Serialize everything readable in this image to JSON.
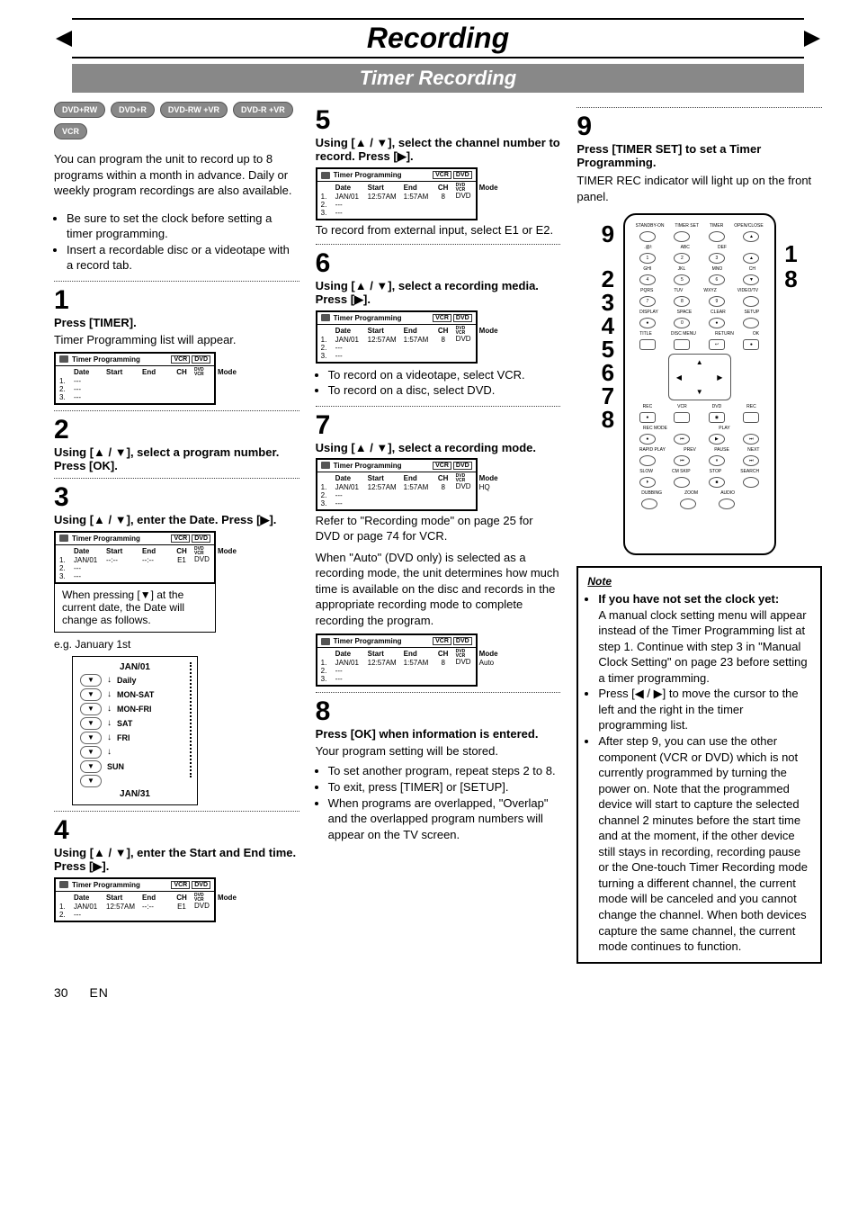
{
  "page_title": "Recording",
  "subtitle": "Timer Recording",
  "disc_badges": [
    "DVD+RW",
    "DVD+R",
    "DVD-RW +VR",
    "DVD-R +VR",
    "VCR"
  ],
  "intro_paragraph": "You can program the unit to record up to 8 programs within a month in advance. Daily or weekly program recordings are also available.",
  "intro_bullets": [
    "Be sure to set the clock before setting a timer programming.",
    "Insert a recordable disc or a videotape with a record tab."
  ],
  "timer_programming_label": "Timer Programming",
  "timer_indicators": [
    "VCR",
    "DVD"
  ],
  "timer_headers": {
    "date": "Date",
    "start": "Start",
    "end": "End",
    "ch": "CH",
    "dvdvcr_top": "DVD",
    "dvdvcr_bot": "VCR",
    "mode": "Mode"
  },
  "steps": {
    "1": {
      "title": "Press [TIMER].",
      "sub": "Timer Programming list will appear.",
      "rows": [
        {
          "n": "1.",
          "date": "---"
        },
        {
          "n": "2.",
          "date": "---"
        },
        {
          "n": "3.",
          "date": "---"
        }
      ]
    },
    "2": {
      "title": "Using [▲ / ▼], select a program number. Press [OK]."
    },
    "3": {
      "title": "Using [▲ / ▼], enter the Date. Press [▶].",
      "rows": [
        {
          "n": "1.",
          "date": "JAN/01",
          "start": "--:--",
          "end": "--:--",
          "ch": "E1",
          "dv": "DVD"
        },
        {
          "n": "2.",
          "date": "---"
        },
        {
          "n": "3.",
          "date": "---"
        }
      ],
      "callout": "When pressing [▼] at the current date, the Date will change as follows.",
      "eg": "e.g. January 1st",
      "loop": [
        "JAN/01",
        "Daily",
        "MON-SAT",
        "MON-FRI",
        "SAT",
        "FRI",
        "SUN",
        "JAN/31"
      ]
    },
    "4": {
      "title": "Using [▲ / ▼], enter the Start and End time. Press [▶].",
      "rows": [
        {
          "n": "1.",
          "date": "JAN/01",
          "start": "12:57AM",
          "end": "--:--",
          "ch": "E1",
          "dv": "DVD"
        },
        {
          "n": "2.",
          "date": "---"
        }
      ]
    },
    "5": {
      "title": "Using [▲ / ▼], select the channel number to record. Press [▶].",
      "rows": [
        {
          "n": "1.",
          "date": "JAN/01",
          "start": "12:57AM",
          "end": "1:57AM",
          "ch": "8",
          "dv": "DVD"
        },
        {
          "n": "2.",
          "date": "---"
        },
        {
          "n": "3.",
          "date": "---"
        }
      ],
      "after": "To record from external input, select E1 or E2."
    },
    "6": {
      "title": "Using [▲ / ▼], select a recording media. Press [▶].",
      "rows": [
        {
          "n": "1.",
          "date": "JAN/01",
          "start": "12:57AM",
          "end": "1:57AM",
          "ch": "8",
          "dv": "DVD"
        },
        {
          "n": "2.",
          "date": "---"
        },
        {
          "n": "3.",
          "date": "---"
        }
      ],
      "bullets": [
        "To record on a videotape, select VCR.",
        "To record on a disc, select DVD."
      ]
    },
    "7": {
      "title": "Using [▲ / ▼], select a recording mode.",
      "rows": [
        {
          "n": "1.",
          "date": "JAN/01",
          "start": "12:57AM",
          "end": "1:57AM",
          "ch": "8",
          "dv": "DVD",
          "mode": "HQ"
        },
        {
          "n": "2.",
          "date": "---"
        },
        {
          "n": "3.",
          "date": "---"
        }
      ],
      "para1": "Refer to \"Recording mode\" on page 25 for DVD or page 74 for VCR.",
      "para2": "When \"Auto\" (DVD only) is selected as a recording mode, the unit determines how much time is available on the disc and records in the appropriate recording mode to complete recording the program.",
      "rows2": [
        {
          "n": "1.",
          "date": "JAN/01",
          "start": "12:57AM",
          "end": "1:57AM",
          "ch": "8",
          "dv": "DVD",
          "mode": "Auto"
        },
        {
          "n": "2.",
          "date": "---"
        },
        {
          "n": "3.",
          "date": "---"
        }
      ]
    },
    "8": {
      "title": "Press [OK] when information is entered.",
      "sub": "Your program setting will be stored.",
      "bullets": [
        "To set another program, repeat steps 2 to 8.",
        "To exit, press [TIMER] or [SETUP].",
        "When programs are overlapped, \"Overlap\" and the overlapped program numbers will appear on the TV screen."
      ]
    },
    "9": {
      "title": "Press [TIMER SET] to set a Timer Programming.",
      "sub": "TIMER REC indicator will light up on the front panel."
    }
  },
  "note": {
    "heading": "Note",
    "lead": "If you have not set the clock yet:",
    "para": "A manual clock setting menu will appear instead of the Timer Programming list at step 1. Continue with step 3 in \"Manual Clock Setting\" on page 23 before setting a timer programming.",
    "b2": "Press [◀ / ▶] to move the cursor to the left and the right in the timer programming list.",
    "b3": "After step 9, you can use the other component (VCR or DVD) which is not currently programmed by turning the power on. Note that the programmed device will start to capture the selected channel 2 minutes before the start time and at the moment, if the other device still stays in recording, recording pause or the One-touch Timer Recording mode turning a different channel, the current mode will be canceled and you cannot change the channel. When both devices capture the same channel, the current mode continues to function."
  },
  "remote": {
    "top": [
      "STANDBY-ON",
      "TIMER SET",
      "TIMER",
      "OPEN/CLOSE"
    ],
    "r2": [
      ".@/:",
      "ABC",
      "DEF",
      ""
    ],
    "r2b": [
      "1",
      "2",
      "3",
      "▲"
    ],
    "r3": [
      "GHI",
      "JKL",
      "MNO",
      "CH"
    ],
    "r3b": [
      "4",
      "5",
      "6",
      "▼"
    ],
    "r4": [
      "PQRS",
      "TUV",
      "WXYZ",
      "VIDEO/TV"
    ],
    "r4b": [
      "7",
      "8",
      "9",
      ""
    ],
    "r5": [
      "DISPLAY",
      "SPACE",
      "CLEAR",
      "SETUP"
    ],
    "r5b": [
      "",
      "0",
      "",
      ""
    ],
    "r6": [
      "TITLE",
      "DISC MENU",
      "RETURN",
      "OK"
    ],
    "r7": [
      "REC",
      "VCR",
      "DVD",
      "REC"
    ],
    "r8": [
      "REC MODE",
      "",
      "PLAY",
      ""
    ],
    "r9": [
      "RAPID PLAY",
      "PREV",
      "PAUSE",
      "NEXT"
    ],
    "r10": [
      "SLOW",
      "CM SKIP",
      "STOP",
      "SEARCH"
    ],
    "r11": [
      "DUBBING",
      "ZOOM",
      "AUDIO",
      ""
    ]
  },
  "callout_numbers_left": [
    "9",
    "2",
    "3",
    "4",
    "5",
    "6",
    "7",
    "8"
  ],
  "callout_numbers_right": [
    "1",
    "8"
  ],
  "footer_page": "30",
  "footer_lang": "EN"
}
